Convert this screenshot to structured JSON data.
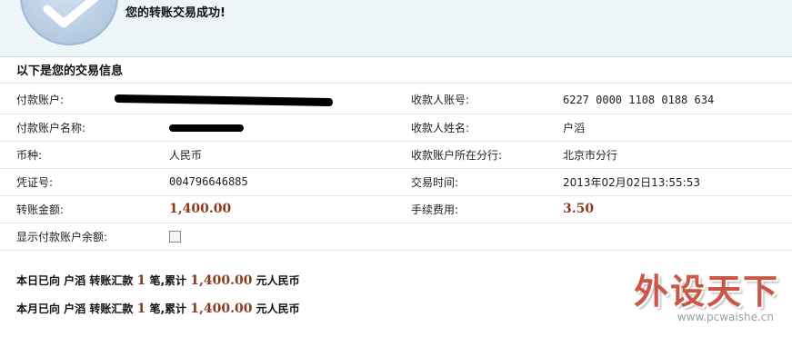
{
  "banner": {
    "message": "您的转账交易成功!"
  },
  "section_title": "以下是您的交易信息",
  "rows": [
    {
      "label_left": "付款账户:",
      "value_left": "",
      "label_right": "收款人账号:",
      "value_right": "6227 0000 1108 0188 634"
    },
    {
      "label_left": "付款账户名称:",
      "value_left": "",
      "label_right": "收款人姓名:",
      "value_right": "户滔"
    },
    {
      "label_left": "币种:",
      "value_left": "人民币",
      "label_right": "收款账户所在分行:",
      "value_right": "北京市分行"
    },
    {
      "label_left": "凭证号:",
      "value_left": "004796646885",
      "label_right": "交易时间:",
      "value_right": "2013年02月02日13:55:53"
    },
    {
      "label_left": "转账金额:",
      "value_left": "1,400.00",
      "label_right": "手续费用:",
      "value_right": "3.50"
    },
    {
      "label_left": "显示付款账户余额:",
      "checkbox_checked": false
    }
  ],
  "summary_day": {
    "prefix": "本日已向 户滔 转账汇款",
    "count": "1",
    "mid": "笔,累计",
    "total": "1,400.00",
    "suffix": "元人民币"
  },
  "summary_month": {
    "prefix": "本月已向 户滔 转账汇款",
    "count": "1",
    "mid": "笔,累计",
    "total": "1,400.00",
    "suffix": "元人民币"
  },
  "watermark": {
    "title": "外设天下",
    "url": "www.pcwaishe.cn"
  },
  "colors": {
    "amount": "#8b3a1e",
    "banner_bg": "#eef5f9",
    "watermark": "#c33a2a"
  }
}
